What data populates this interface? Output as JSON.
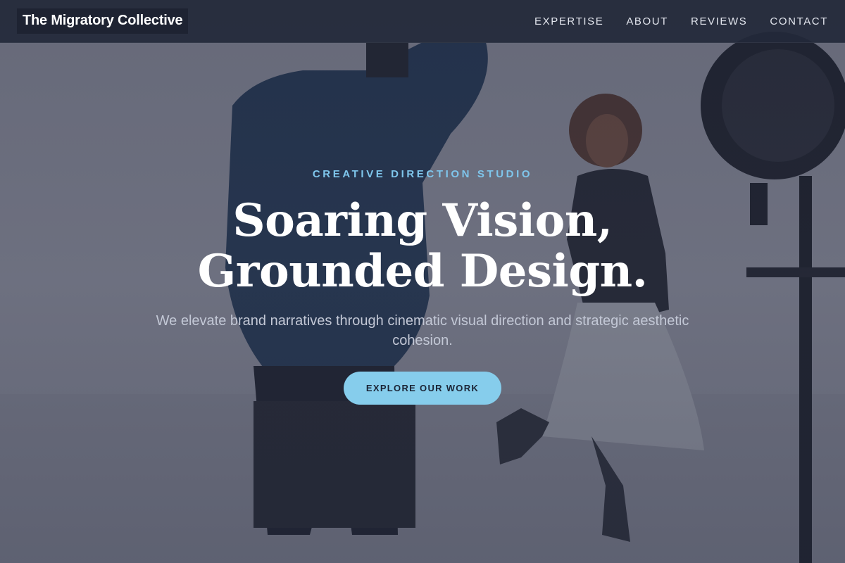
{
  "nav": {
    "brand": "The Migratory Collective",
    "links": [
      {
        "label": "EXPERTISE"
      },
      {
        "label": "ABOUT"
      },
      {
        "label": "REVIEWS"
      },
      {
        "label": "CONTACT"
      }
    ]
  },
  "hero": {
    "eyebrow": "CREATIVE DIRECTION STUDIO",
    "headline_line1": "Soaring Vision,",
    "headline_line2": "Grounded Design.",
    "subtext": "We elevate brand narratives through cinematic visual direction and strategic aesthetic cohesion.",
    "cta_label": "EXPLORE OUR WORK"
  },
  "colors": {
    "accent": "#86cdec",
    "eyebrow": "#7fc6ec",
    "nav_bg": "#23293a"
  }
}
